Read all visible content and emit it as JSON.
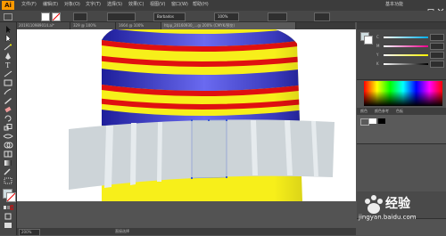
{
  "app": {
    "logo": "Ai"
  },
  "menu": {
    "items": [
      "文件(F)",
      "编辑(E)",
      "对象(O)",
      "文字(T)",
      "选择(S)",
      "效果(C)",
      "视图(V)",
      "窗口(W)",
      "帮助(H)"
    ]
  },
  "workspace": {
    "label": "基本功能"
  },
  "control_bar": {
    "font_name": "Barbados",
    "opacity_value": "100%"
  },
  "tabs": [
    {
      "label": "2019110989014.ai*"
    },
    {
      "label": "329 @ 100%"
    },
    {
      "label": "1664 @ 100%"
    },
    {
      "label": "htpp_20160930_...@ 200% (CMYK/预览)"
    }
  ],
  "status": {
    "zoom": "200%",
    "mode": "直接选择"
  },
  "panels": {
    "color_labels": [
      "C",
      "M",
      "Y",
      "K"
    ],
    "tabs": [
      "颜色",
      "颜色参考",
      "色板"
    ]
  },
  "watermark": {
    "text": "经验",
    "sub": "jingyan.baidu.com"
  },
  "colors": {
    "stripe_blue": "#3a3ac8",
    "stripe_red": "#e01010",
    "stripe_yellow": "#f7ef1a",
    "brim": "#cfd6da"
  }
}
